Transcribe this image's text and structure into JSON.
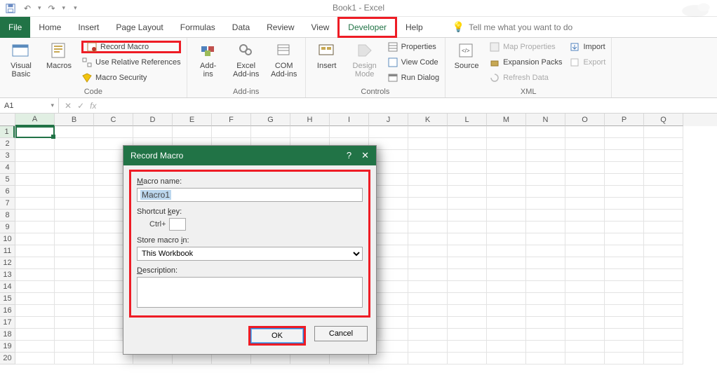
{
  "qat": {
    "save_icon": "save-icon",
    "undo_icon": "undo-icon",
    "redo_icon": "redo-icon"
  },
  "title": {
    "doc": "Book1",
    "suffix": " - Excel"
  },
  "tabs": {
    "file": "File",
    "items": [
      "Home",
      "Insert",
      "Page Layout",
      "Formulas",
      "Data",
      "Review",
      "View",
      "Developer",
      "Help"
    ],
    "active": "Developer",
    "tellme_placeholder": "Tell me what you want to do"
  },
  "ribbon": {
    "group_code": {
      "label": "Code",
      "visual_basic": "Visual\nBasic",
      "macros": "Macros",
      "record_macro": "Record Macro",
      "use_rel_refs": "Use Relative References",
      "macro_security": "Macro Security"
    },
    "group_addins": {
      "label": "Add-ins",
      "addins": "Add-\nins",
      "excel_addins": "Excel\nAdd-ins",
      "com_addins": "COM\nAdd-ins"
    },
    "group_controls": {
      "label": "Controls",
      "insert": "Insert",
      "design_mode": "Design\nMode",
      "properties": "Properties",
      "view_code": "View Code",
      "run_dialog": "Run Dialog"
    },
    "group_xml": {
      "label": "XML",
      "source": "Source",
      "map_properties": "Map Properties",
      "expansion_packs": "Expansion Packs",
      "refresh_data": "Refresh Data",
      "import": "Import",
      "export": "Export"
    }
  },
  "fxbar": {
    "namebox": "A1",
    "fx": "fx"
  },
  "grid": {
    "cols": [
      "A",
      "B",
      "C",
      "D",
      "E",
      "F",
      "G",
      "H",
      "I",
      "J",
      "K",
      "L",
      "M",
      "N",
      "O",
      "P",
      "Q"
    ],
    "rows": [
      1,
      2,
      3,
      4,
      5,
      6,
      7,
      8,
      9,
      10,
      11,
      12,
      13,
      14,
      15,
      16,
      17,
      18,
      19,
      20
    ],
    "selected_cell": "A1"
  },
  "dialog": {
    "title": "Record Macro",
    "macro_name_label": "Macro name:",
    "macro_name_value": "Macro1",
    "shortcut_label": "Shortcut key:",
    "shortcut_prefix": "Ctrl+",
    "shortcut_value": "",
    "store_label": "Store macro in:",
    "store_option": "This Workbook",
    "description_label": "Description:",
    "description_value": "",
    "ok": "OK",
    "cancel": "Cancel"
  }
}
